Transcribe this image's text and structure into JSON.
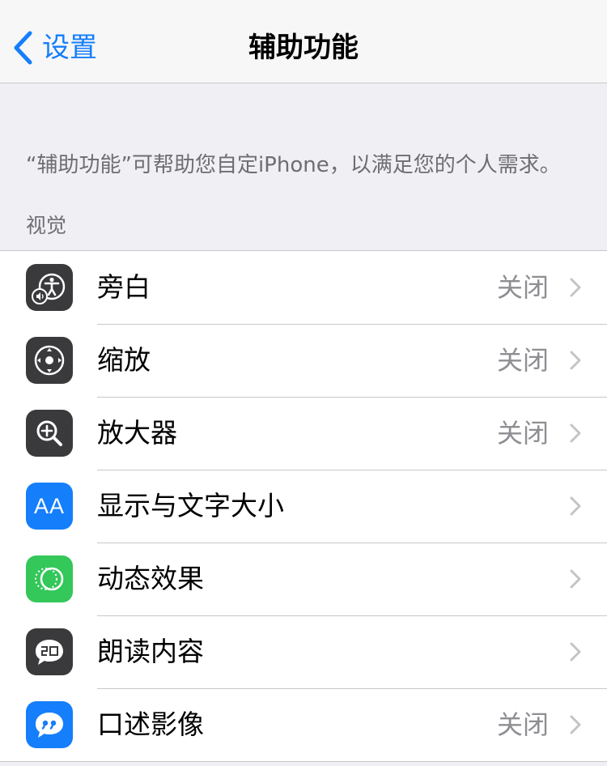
{
  "nav": {
    "back_label": "设置",
    "title": "辅助功能"
  },
  "description": "“辅助功能”可帮助您自定iPhone，以满足您的个人需求。",
  "section": {
    "header": "视觉",
    "items": [
      {
        "label": "旁白",
        "value": "关闭",
        "icon": "voiceover-icon",
        "color": "#3a3a3c"
      },
      {
        "label": "缩放",
        "value": "关闭",
        "icon": "zoom-icon",
        "color": "#3a3a3c"
      },
      {
        "label": "放大器",
        "value": "关闭",
        "icon": "magnifier-icon",
        "color": "#3a3a3c"
      },
      {
        "label": "显示与文字大小",
        "value": "",
        "icon": "text-size-icon",
        "icon_text": "AA",
        "color": "#157efb"
      },
      {
        "label": "动态效果",
        "value": "",
        "icon": "motion-icon",
        "color": "#34c759"
      },
      {
        "label": "朗读内容",
        "value": "",
        "icon": "spoken-content-icon",
        "color": "#3a3a3c"
      },
      {
        "label": "口述影像",
        "value": "关闭",
        "icon": "audio-description-icon",
        "color": "#157efb"
      }
    ]
  },
  "colors": {
    "accent": "#157efb",
    "background": "#efeff4",
    "secondary_text": "#8e8e93",
    "separator": "#c8c7cc"
  }
}
